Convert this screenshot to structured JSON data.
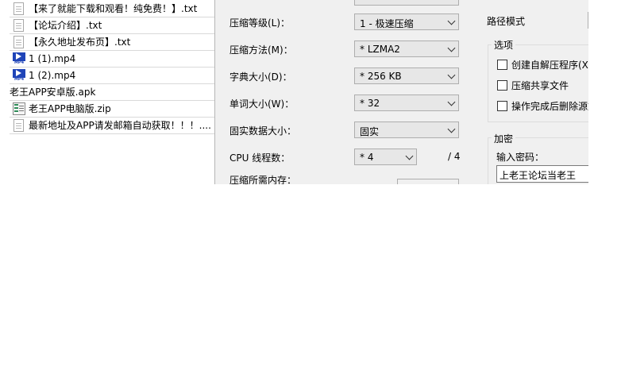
{
  "files": [
    {
      "name": "【来了就能下载和观看！纯免费！】.txt",
      "icon": "txt-file-icon"
    },
    {
      "name": "【论坛介绍】.txt",
      "icon": "txt-file-icon"
    },
    {
      "name": "【永久地址发布页】.txt",
      "icon": "txt-file-icon"
    },
    {
      "name": "1 (1).mp4",
      "icon": "mp4-file-icon"
    },
    {
      "name": "1 (2).mp4",
      "icon": "mp4-file-icon"
    },
    {
      "name": "老王APP安卓版.apk",
      "icon": "apk-file-icon"
    },
    {
      "name": "老王APP电脑版.zip",
      "icon": "zip-file-icon"
    },
    {
      "name": "最新地址及APP请发邮箱自动获取！！！....",
      "icon": "txt-file-icon"
    }
  ],
  "mp4_icon_text": "MP4",
  "dialog": {
    "compression_level_label": "压缩等级(L)：",
    "compression_level_value": "1 - 极速压缩",
    "compression_method_label": "压缩方法(M)：",
    "compression_method_value": "* LZMA2",
    "dictionary_size_label": "字典大小(D)：",
    "dictionary_size_value": "* 256 KB",
    "word_size_label": "单词大小(W)：",
    "word_size_value": "* 32",
    "solid_block_label": "固实数据大小：",
    "solid_block_value": "固实",
    "cpu_threads_label": "CPU 线程数：",
    "cpu_threads_value": "* 4",
    "cpu_threads_max": "/ 4",
    "memory_label": "压缩所需内存：",
    "path_mode_label": "路径模式",
    "options_title": "选项",
    "options": [
      {
        "label": "创建自解压程序(X)",
        "checked": false
      },
      {
        "label": "压缩共享文件",
        "checked": false
      },
      {
        "label": "操作完成后删除源文",
        "checked": false
      }
    ],
    "encryption_title": "加密",
    "password_label": "输入密码：",
    "password_value": "上老王论坛当老王"
  }
}
